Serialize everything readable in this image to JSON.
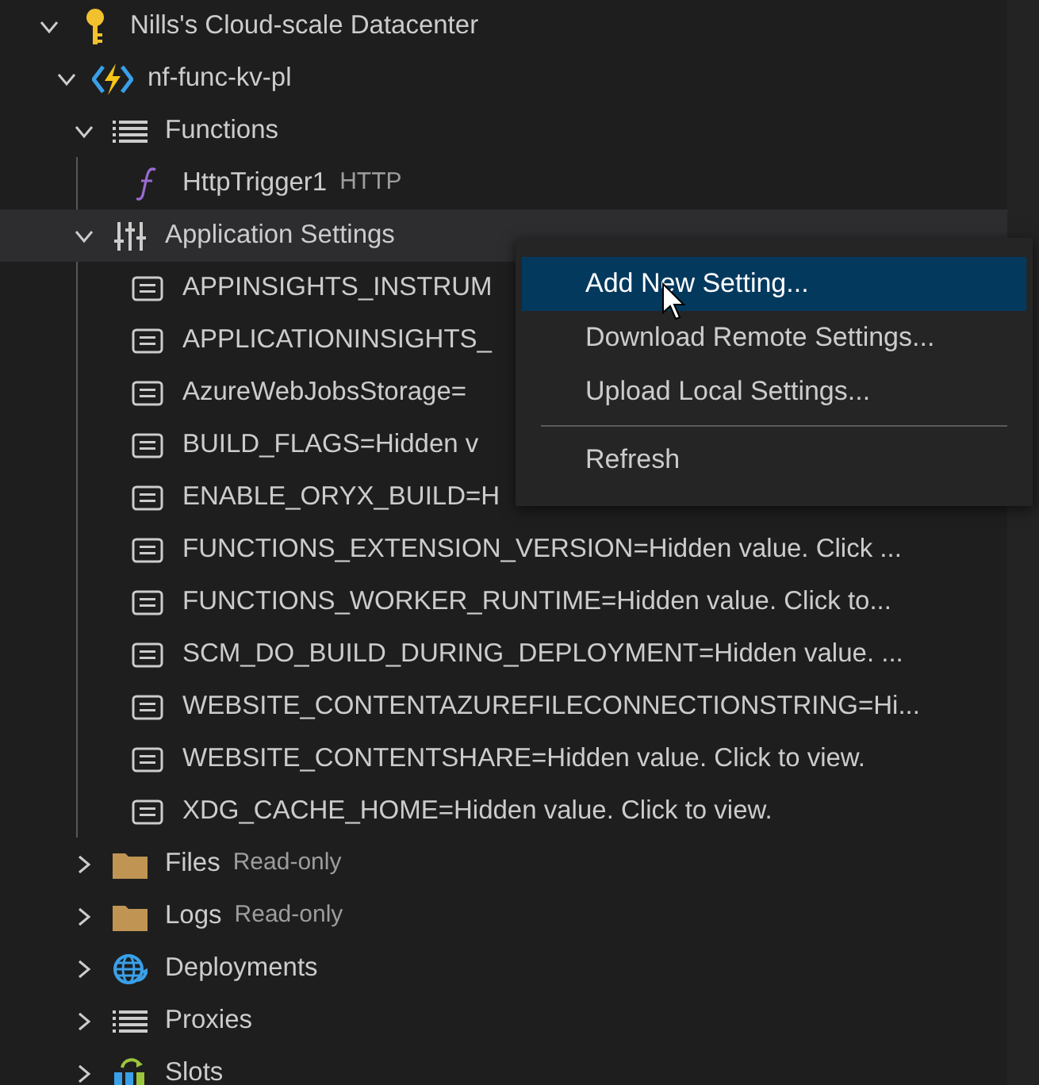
{
  "tree": [
    {
      "label": "Nills's Cloud-scale Datacenter",
      "kind": "key",
      "expanded": true,
      "selected": false,
      "children": [
        {
          "label": "nf-func-kv-pl",
          "kind": "function-app",
          "expanded": true,
          "selected": false,
          "children": [
            {
              "label": "Functions",
              "kind": "list",
              "expanded": true,
              "selected": false,
              "children": [
                {
                  "label": "HttpTrigger1",
                  "description": "HTTP",
                  "kind": "function",
                  "selected": false
                }
              ]
            },
            {
              "label": "Application Settings",
              "kind": "sliders",
              "expanded": true,
              "selected": true,
              "children": [
                {
                  "label": "APPINSIGHTS_INSTRUM",
                  "kind": "setting",
                  "selected": false
                },
                {
                  "label": "APPLICATIONINSIGHTS_",
                  "kind": "setting",
                  "selected": false
                },
                {
                  "label": "AzureWebJobsStorage=",
                  "kind": "setting",
                  "selected": false
                },
                {
                  "label": "BUILD_FLAGS=Hidden v",
                  "kind": "setting",
                  "selected": false
                },
                {
                  "label": "ENABLE_ORYX_BUILD=H",
                  "kind": "setting",
                  "selected": false
                },
                {
                  "label": "FUNCTIONS_EXTENSION_VERSION=Hidden value. Click ...",
                  "kind": "setting",
                  "selected": false
                },
                {
                  "label": "FUNCTIONS_WORKER_RUNTIME=Hidden value. Click to...",
                  "kind": "setting",
                  "selected": false
                },
                {
                  "label": "SCM_DO_BUILD_DURING_DEPLOYMENT=Hidden value. ...",
                  "kind": "setting",
                  "selected": false
                },
                {
                  "label": "WEBSITE_CONTENTAZUREFILECONNECTIONSTRING=Hi...",
                  "kind": "setting",
                  "selected": false
                },
                {
                  "label": "WEBSITE_CONTENTSHARE=Hidden value. Click to view.",
                  "kind": "setting",
                  "selected": false
                },
                {
                  "label": "XDG_CACHE_HOME=Hidden value. Click to view.",
                  "kind": "setting",
                  "selected": false
                }
              ]
            },
            {
              "label": "Files",
              "description": "Read-only",
              "kind": "folder",
              "expanded": false,
              "selected": false
            },
            {
              "label": "Logs",
              "description": "Read-only",
              "kind": "folder",
              "expanded": false,
              "selected": false
            },
            {
              "label": "Deployments",
              "kind": "globe",
              "expanded": false,
              "selected": false
            },
            {
              "label": "Proxies",
              "kind": "list",
              "expanded": false,
              "selected": false
            },
            {
              "label": "Slots",
              "kind": "slots",
              "expanded": false,
              "selected": false
            }
          ]
        }
      ]
    }
  ],
  "context_menu": [
    {
      "kind": "item",
      "label": "Add New Setting...",
      "selected": true
    },
    {
      "kind": "item",
      "label": "Download Remote Settings...",
      "selected": false
    },
    {
      "kind": "item",
      "label": "Upload Local Settings...",
      "selected": false
    },
    {
      "kind": "separator"
    },
    {
      "kind": "item",
      "label": "Refresh",
      "selected": false
    }
  ]
}
